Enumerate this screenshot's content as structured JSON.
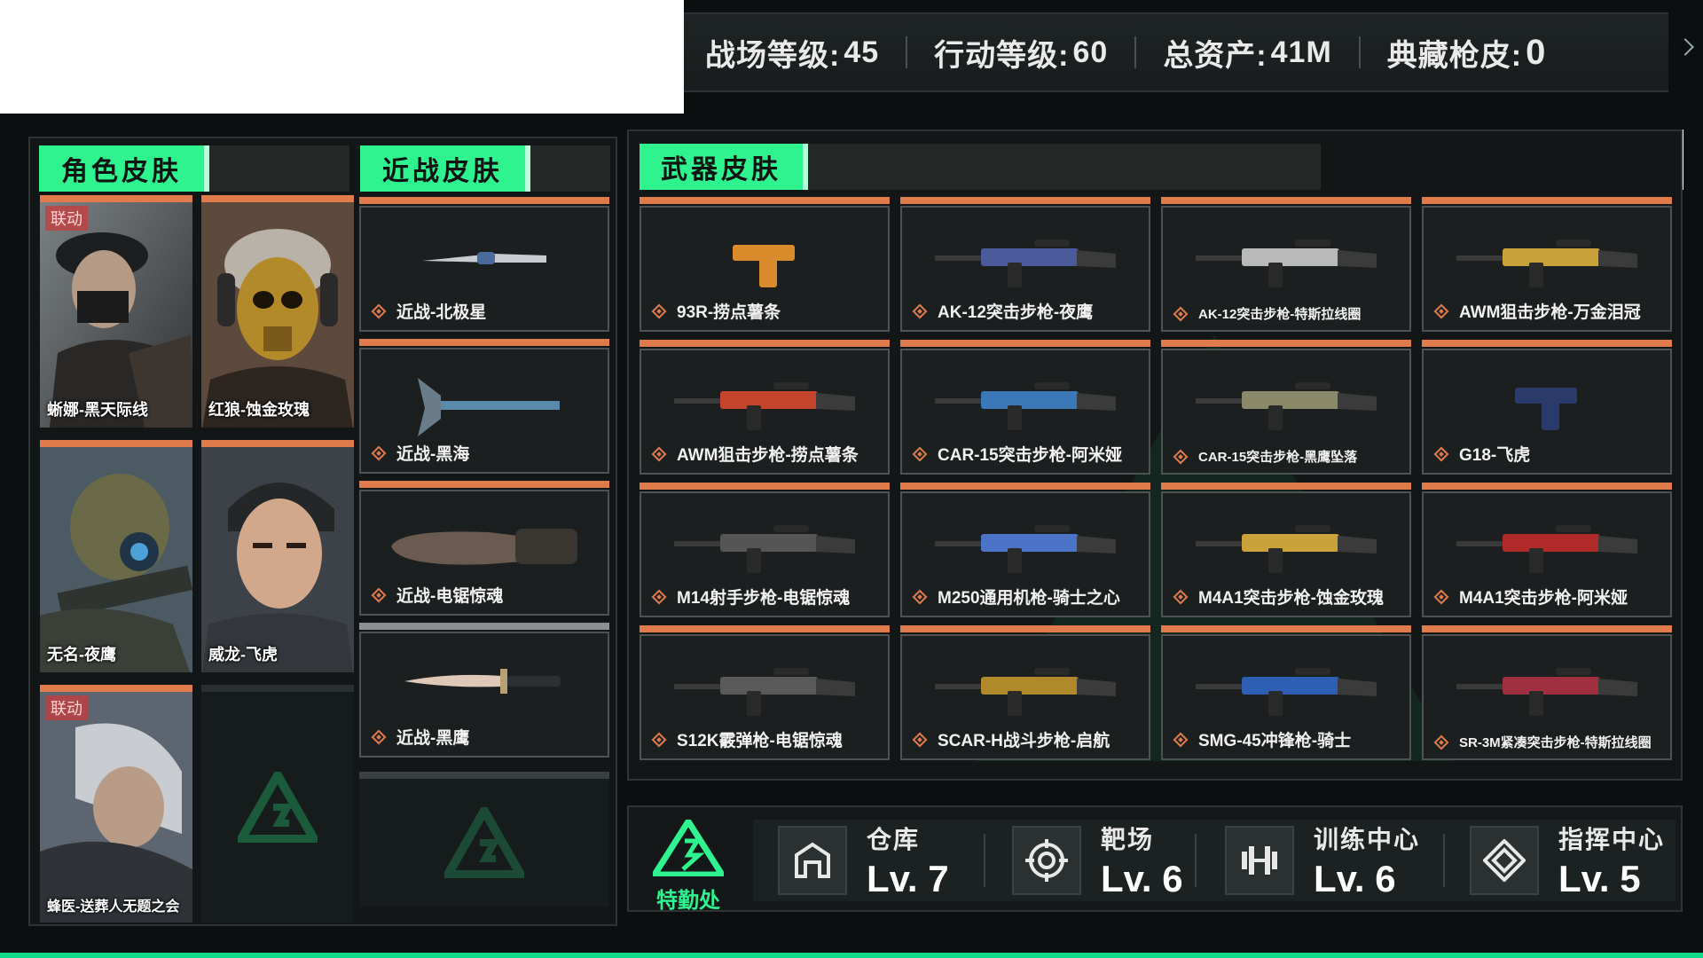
{
  "stats": [
    {
      "label": "战场等级:",
      "value": "45"
    },
    {
      "label": "行动等级: ",
      "value": "60"
    },
    {
      "label": "总资产:",
      "value": "41M"
    },
    {
      "label": "典藏枪皮:",
      "value": "0"
    }
  ],
  "sections": {
    "characters": "角色皮肤",
    "melee": "近战皮肤",
    "weapons": "武器皮肤"
  },
  "characters": [
    {
      "name": "蜥娜-黑天际线",
      "badge": "联动"
    },
    {
      "name": "红狼-蚀金玫瑰",
      "badge": ""
    },
    {
      "name": "无名-夜鹰",
      "badge": ""
    },
    {
      "name": "威龙-飞虎",
      "badge": ""
    },
    {
      "name": "蜂医-送葬人无题之会",
      "badge": "联动"
    }
  ],
  "melee": [
    {
      "name": "近战-北极星",
      "icon": "knife-icon"
    },
    {
      "name": "近战-黑海",
      "icon": "axe-icon"
    },
    {
      "name": "近战-电锯惊魂",
      "icon": "chainsaw-icon"
    },
    {
      "name": "近战-黑鹰",
      "icon": "dagger-icon"
    }
  ],
  "weapons": [
    {
      "name": "93R-捞点薯条",
      "color": "#d98a2b"
    },
    {
      "name": "AK-12突击步枪-夜鹰",
      "color": "#4a5a9a"
    },
    {
      "name": "AK-12突击步枪-特斯拉线圈",
      "color": "#b9b9b9"
    },
    {
      "name": "AWM狙击步枪-万金泪冠",
      "color": "#c9a23a"
    },
    {
      "name": "AWM狙击步枪-捞点薯条",
      "color": "#c4452c"
    },
    {
      "name": "CAR-15突击步枪-阿米娅",
      "color": "#3b78b8"
    },
    {
      "name": "CAR-15突击步枪-黑鹰坠落",
      "color": "#8a8a6a"
    },
    {
      "name": "G18-飞虎",
      "color": "#2a3a6a"
    },
    {
      "name": "M14射手步枪-电锯惊魂",
      "color": "#555555"
    },
    {
      "name": "M250通用机枪-骑士之心",
      "color": "#4b73c8"
    },
    {
      "name": "M4A1突击步枪-蚀金玫瑰",
      "color": "#c9a23a"
    },
    {
      "name": "M4A1突击步枪-阿米娅",
      "color": "#b02a2a"
    },
    {
      "name": "S12K霰弹枪-电锯惊魂",
      "color": "#5a5a5a"
    },
    {
      "name": "SCAR-H战斗步枪-启航",
      "color": "#b08a2a"
    },
    {
      "name": "SMG-45冲锋枪-骑士",
      "color": "#2f5fb5"
    },
    {
      "name": "SR-3M紧凑突击步枪-特斯拉线圈",
      "color": "#a03040"
    }
  ],
  "depot": {
    "name": "特勤处"
  },
  "facilities": [
    {
      "name": "仓库",
      "level": "Lv. 7",
      "icon": "warehouse-icon"
    },
    {
      "name": "靶场",
      "level": "Lv. 6",
      "icon": "target-icon"
    },
    {
      "name": "训练中心",
      "level": "Lv. 6",
      "icon": "dumbbell-icon"
    },
    {
      "name": "指挥中心",
      "level": "Lv. 5",
      "icon": "command-icon"
    }
  ],
  "colors": {
    "accent": "#2ef38f",
    "rarity": "#e07c4c",
    "panel": "#131616"
  }
}
